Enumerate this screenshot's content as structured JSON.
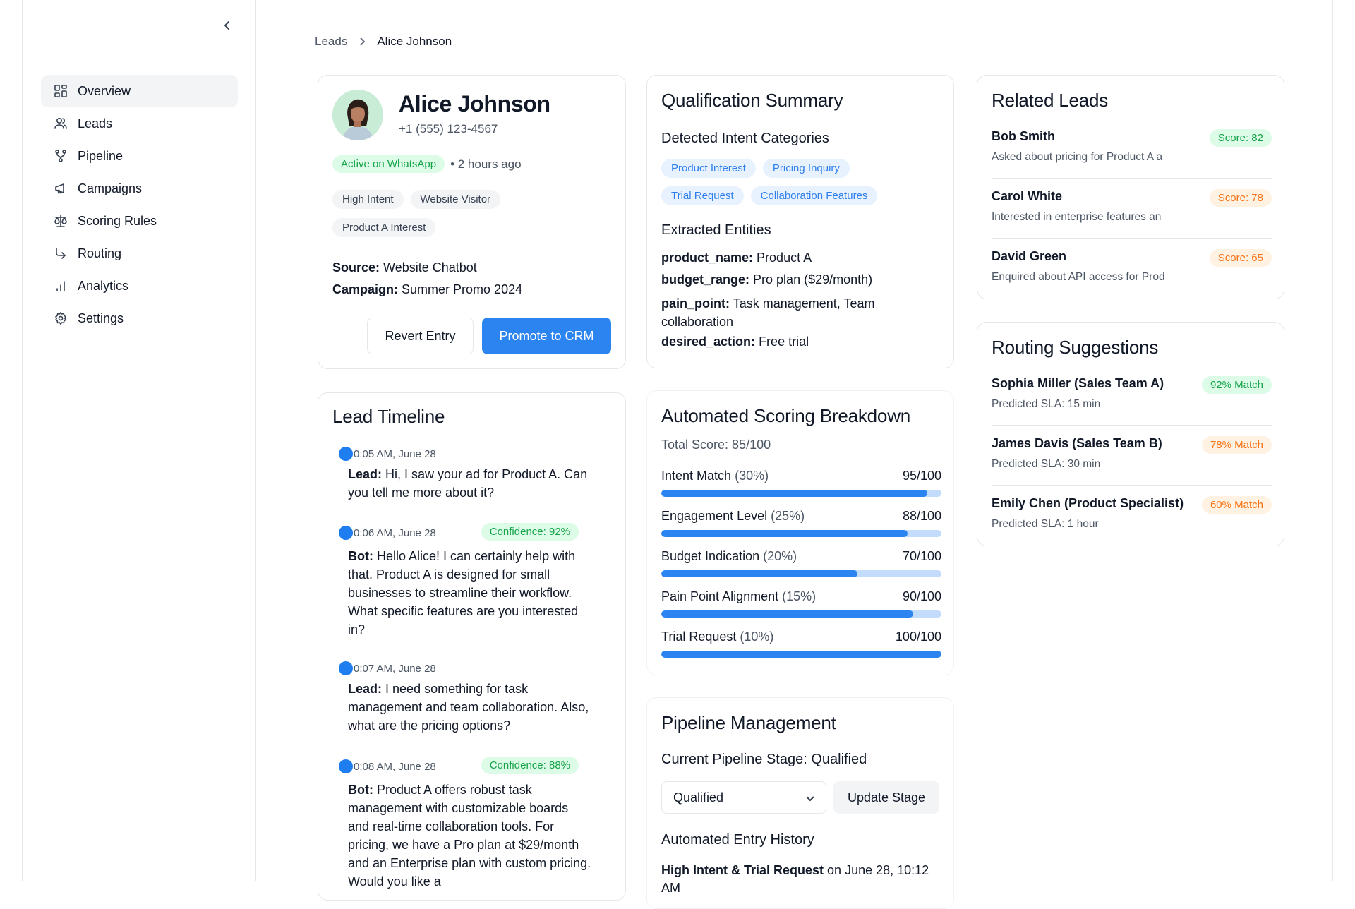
{
  "sidebar": {
    "items": [
      {
        "label": "Overview",
        "icon": "dashboard-icon",
        "active": true
      },
      {
        "label": "Leads",
        "icon": "users-icon"
      },
      {
        "label": "Pipeline",
        "icon": "git-branch-icon"
      },
      {
        "label": "Campaigns",
        "icon": "megaphone-icon"
      },
      {
        "label": "Scoring Rules",
        "icon": "scale-icon"
      },
      {
        "label": "Routing",
        "icon": "corner-down-right-icon"
      },
      {
        "label": "Analytics",
        "icon": "bar-chart-icon"
      },
      {
        "label": "Settings",
        "icon": "gear-icon"
      }
    ]
  },
  "breadcrumb": {
    "parent": "Leads",
    "current": "Alice Johnson"
  },
  "profile": {
    "name": "Alice Johnson",
    "phone": "+1 (555) 123-4567",
    "status": "Active on WhatsApp",
    "last_seen": "• 2 hours ago",
    "tags": [
      "High Intent",
      "Website Visitor",
      "Product A Interest"
    ],
    "source_label": "Source:",
    "source": "Website Chatbot",
    "campaign_label": "Campaign:",
    "campaign": "Summer Promo 2024",
    "revert_label": "Revert Entry",
    "promote_label": "Promote to CRM"
  },
  "timeline": {
    "title": "Lead Timeline",
    "entries": [
      {
        "time": "0:05 AM, June 28",
        "speaker": "Lead:",
        "text": "Hi, I saw your ad for Product A. Can you tell me more about it?",
        "confidence": ""
      },
      {
        "time": "0:06 AM, June 28",
        "speaker": "Bot:",
        "text": "Hello Alice! I can certainly help with that. Product A is designed for small businesses to streamline their workflow. What specific features are you interested in?",
        "confidence": "Confidence: 92%"
      },
      {
        "time": "0:07 AM, June 28",
        "speaker": "Lead:",
        "text": "I need something for task management and team collaboration. Also, what are the pricing options?",
        "confidence": ""
      },
      {
        "time": "0:08 AM, June 28",
        "speaker": "Bot:",
        "text": "Product A offers robust task management with customizable boards and real-time collaboration tools. For pricing, we have a Pro plan at $29/month and an Enterprise plan with custom pricing. Would you like a",
        "confidence": "Confidence: 88%"
      }
    ]
  },
  "qualification": {
    "title": "Qualification Summary",
    "intent_title": "Detected Intent Categories",
    "intents": [
      "Product Interest",
      "Pricing Inquiry",
      "Trial Request",
      "Collaboration Features"
    ],
    "entities_title": "Extracted Entities",
    "entities": [
      {
        "key": "product_name:",
        "value": "Product A"
      },
      {
        "key": "budget_range:",
        "value": "Pro plan ($29/month)"
      },
      {
        "key": "pain_point:",
        "value": "Task management, Team collaboration"
      },
      {
        "key": "desired_action:",
        "value": "Free trial"
      }
    ]
  },
  "scoring": {
    "title": "Automated Scoring Breakdown",
    "total": "Total Score: 85/100",
    "rows": [
      {
        "label": "Intent Match",
        "weight": "(30%)",
        "value": "95/100",
        "score": 95
      },
      {
        "label": "Engagement Level",
        "weight": "(25%)",
        "value": "88/100",
        "score": 88
      },
      {
        "label": "Budget Indication",
        "weight": "(20%)",
        "value": "70/100",
        "score": 70
      },
      {
        "label": "Pain Point Alignment",
        "weight": "(15%)",
        "value": "90/100",
        "score": 90
      },
      {
        "label": "Trial Request",
        "weight": "(10%)",
        "value": "100/100",
        "score": 100
      }
    ]
  },
  "pipeline": {
    "title": "Pipeline Management",
    "stage_label": "Current Pipeline Stage:",
    "stage": "Qualified",
    "select_value": "Qualified",
    "update_label": "Update Stage",
    "history_title": "Automated Entry History",
    "history_bold": "High Intent & Trial Request",
    "history_rest": "on June 28, 10:12",
    "history_cont": "AM"
  },
  "related": {
    "title": "Related Leads",
    "leads": [
      {
        "name": "Bob Smith",
        "desc": "Asked about pricing for Product A a",
        "score": "Score: 82",
        "tone": "green"
      },
      {
        "name": "Carol White",
        "desc": "Interested in enterprise features an",
        "score": "Score: 78",
        "tone": "orange"
      },
      {
        "name": "David Green",
        "desc": "Enquired about API access for Prod",
        "score": "Score: 65",
        "tone": "orange"
      }
    ]
  },
  "routing": {
    "title": "Routing Suggestions",
    "items": [
      {
        "name": "Sophia Miller (Sales Team A)",
        "sla": "Predicted SLA: 15 min",
        "match": "92% Match",
        "tone": "green"
      },
      {
        "name": "James Davis (Sales Team B)",
        "sla": "Predicted SLA: 30 min",
        "match": "78% Match",
        "tone": "orange"
      },
      {
        "name": "Emily Chen (Product Specialist)",
        "sla": "Predicted SLA: 1 hour",
        "match": "60% Match",
        "tone": "orange"
      }
    ]
  },
  "colors": {
    "accent": "#2b84f0",
    "green": "#16a34a",
    "orange": "#f97316"
  }
}
